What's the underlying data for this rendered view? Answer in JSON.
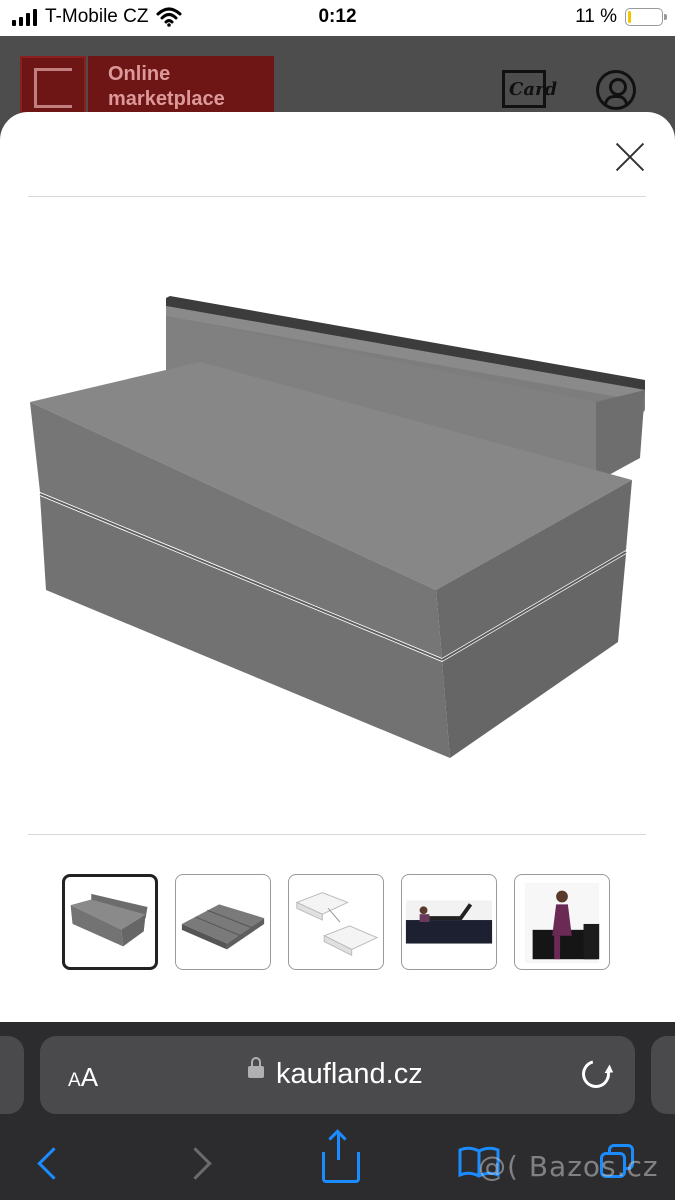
{
  "status_bar": {
    "carrier": "T-Mobile CZ",
    "time": "0:12",
    "battery_percent": "11 %",
    "battery_level": 0.11
  },
  "site_header": {
    "brand_text": "Online marketplace",
    "card_label": "Card"
  },
  "gallery": {
    "main_image": "grey-folding-foam-sofa-bed",
    "selected_index": 0,
    "thumbnails": [
      {
        "name": "sofa-angle"
      },
      {
        "name": "unfolded-mattress"
      },
      {
        "name": "dimension-drawing"
      },
      {
        "name": "woman-lying-on-mattress"
      },
      {
        "name": "woman-sitting-on-sofa"
      }
    ]
  },
  "browser": {
    "aa_label_small": "A",
    "aa_label_large": "A",
    "url": "kaufland.cz",
    "accent_color": "#1a8cff"
  },
  "watermark": "@( Bazos.cz"
}
